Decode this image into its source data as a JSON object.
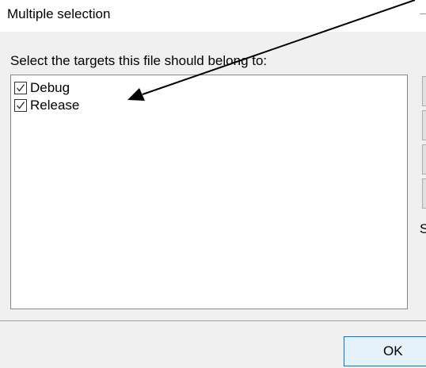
{
  "dialog": {
    "title": "Multiple selection",
    "prompt": "Select the targets this file should belong to:",
    "targets": [
      {
        "label": "Debug",
        "checked": true
      },
      {
        "label": "Release",
        "checked": true
      }
    ],
    "side_letter": "S",
    "ok_label": "OK"
  },
  "colors": {
    "dialog_bg": "#f0f0f0",
    "ok_border": "#0078d7",
    "ok_bg": "#e5f1fb"
  },
  "icons": {
    "checkbox": "checkmark-icon",
    "annotation": "arrow-icon"
  }
}
